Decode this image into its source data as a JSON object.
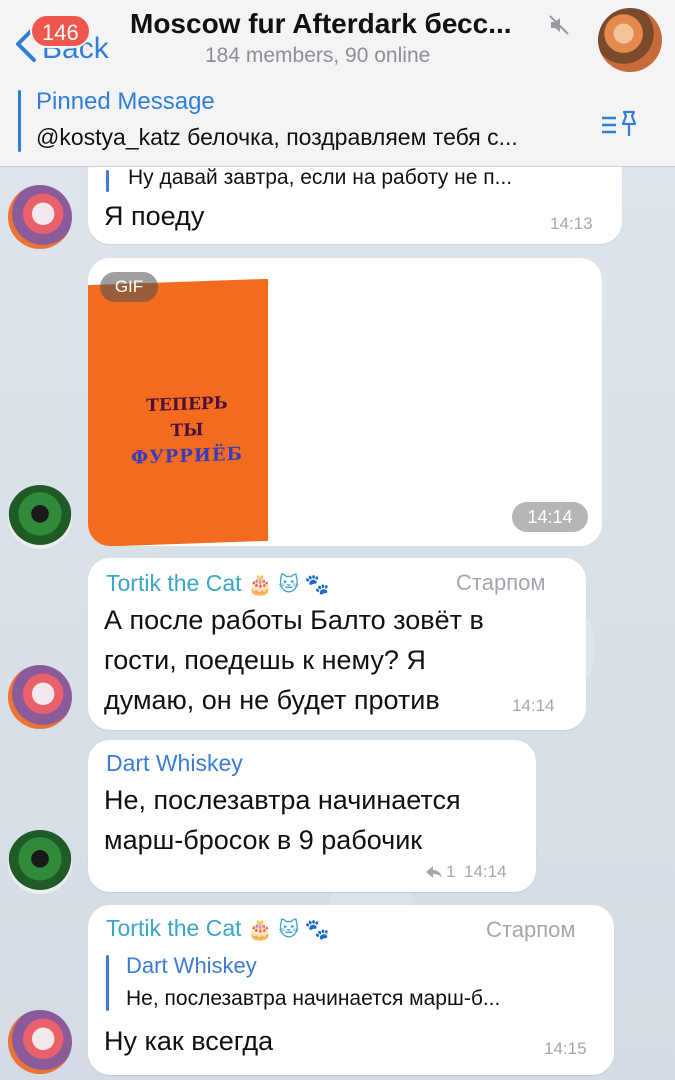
{
  "header": {
    "back_label": "Back",
    "unread_badge": "146",
    "title": "Moscow fur Afterdark бесс...",
    "subtitle": "184 members, 90 online",
    "mute_icon": "muted-speaker-icon"
  },
  "pinned": {
    "title": "Pinned Message",
    "text": "@kostya_katz белочка, поздравляем тебя с..."
  },
  "messages": [
    {
      "reply_text": "Ну давай завтра, если на работу не п...",
      "text": "Я поеду",
      "time": "14:13"
    },
    {
      "type": "gif",
      "gif_label": "GIF",
      "gif_caption": [
        "ТЕПЕРЬ",
        "ТЫ",
        "ФУРРИЁБ"
      ],
      "time": "14:14"
    },
    {
      "sender": "Tortik the Cat",
      "emojis": "🎂 🐱 🐾",
      "role": "Старпом",
      "lines": [
        "А после работы Балто зовёт в",
        "гости, поедешь к нему? Я",
        "думаю, он не будет против"
      ],
      "time": "14:14"
    },
    {
      "sender": "Dart Whiskey",
      "lines": [
        "Не, послезавтра начинается",
        "марш-бросок в 9 рабочик"
      ],
      "replies": "1",
      "time": "14:14"
    },
    {
      "sender": "Tortik the Cat",
      "emojis": "🎂 🐱 🐾",
      "role": "Старпом",
      "reply_name": "Dart Whiskey",
      "reply_text": "Не, послезавтра начинается марш-б...",
      "text": "Ну как всегда",
      "time": "14:15"
    }
  ],
  "colors": {
    "accent": "#2f7fd9",
    "badge": "#f0564b",
    "sender_tortik": "#3aa6c9",
    "sender_dart": "#3b7cd6"
  }
}
